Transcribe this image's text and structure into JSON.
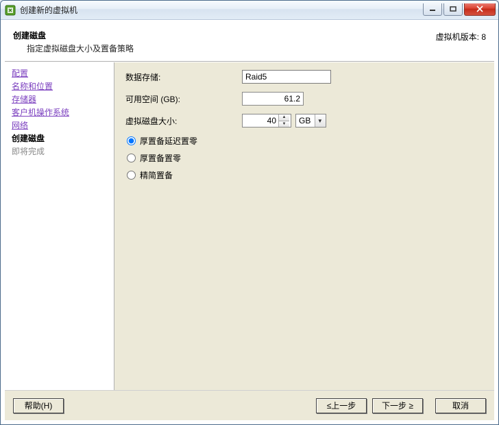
{
  "window": {
    "title": "创建新的虚拟机"
  },
  "header": {
    "title": "创建磁盘",
    "subtitle": "指定虚拟磁盘大小及置备策略",
    "version_label": "虚拟机版本: 8"
  },
  "nav": {
    "steps": [
      "配置",
      "名称和位置",
      "存储器",
      "客户机操作系统",
      "网络"
    ],
    "current": "创建磁盘",
    "pending": "即将完成"
  },
  "form": {
    "datastore_label": "数据存储:",
    "datastore_value": "Raid5",
    "avail_label": "可用空间 (GB):",
    "avail_value": "61.2",
    "size_label": "虚拟磁盘大小:",
    "size_value": "40",
    "size_unit": "GB",
    "provisioning": {
      "options": [
        "厚置备延迟置零",
        "厚置备置零",
        "精简置备"
      ],
      "selected_index": 0
    }
  },
  "footer": {
    "help": "帮助(H)",
    "back": "≤上一步",
    "next": "下一步 ≥",
    "cancel": "取消"
  }
}
